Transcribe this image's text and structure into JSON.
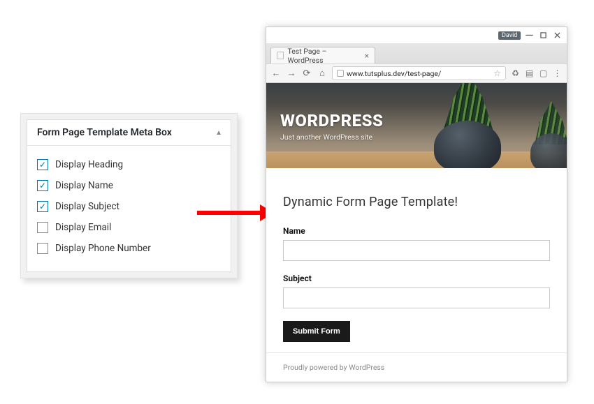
{
  "metabox": {
    "title": "Form Page Template Meta Box",
    "options": [
      {
        "label": "Display Heading",
        "checked": true
      },
      {
        "label": "Display Name",
        "checked": true
      },
      {
        "label": "Display Subject",
        "checked": true
      },
      {
        "label": "Display Email",
        "checked": false
      },
      {
        "label": "Display Phone Number",
        "checked": false
      }
    ]
  },
  "browser": {
    "user_badge": "David",
    "tab": {
      "title": "Test Page – WordPress"
    },
    "url": "www.tutsplus.dev/test-page/"
  },
  "site": {
    "title": "WORDPRESS",
    "tagline": "Just another WordPress site",
    "page_heading": "Dynamic Form Page Template!",
    "form": {
      "name_label": "Name",
      "subject_label": "Subject",
      "submit_label": "Submit Form"
    },
    "footer": "Proudly powered by WordPress"
  }
}
